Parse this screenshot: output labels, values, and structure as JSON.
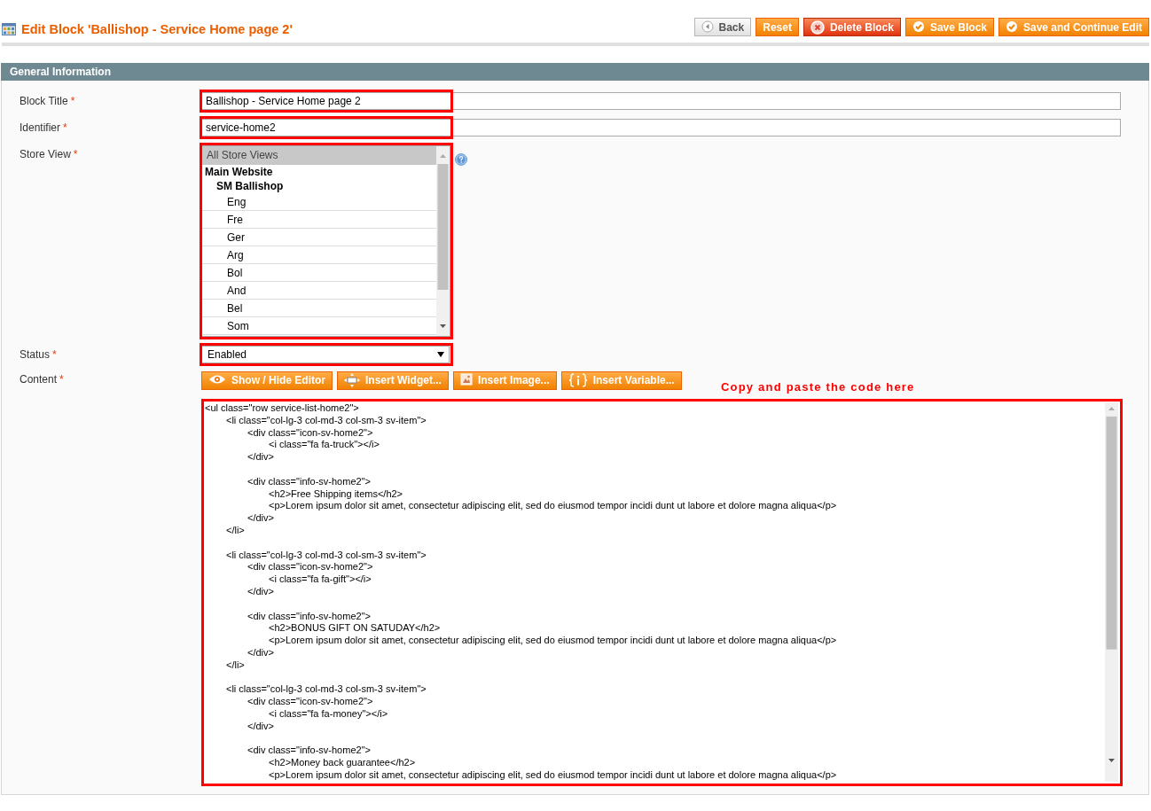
{
  "page": {
    "title": "Edit Block 'Ballishop - Service Home page 2'"
  },
  "header_buttons": [
    {
      "label": "Back",
      "kind": "back"
    },
    {
      "label": "Reset",
      "kind": "reset"
    },
    {
      "label": "Delete Block",
      "kind": "delete"
    },
    {
      "label": "Save Block",
      "kind": "save"
    },
    {
      "label": "Save and Continue Edit",
      "kind": "save"
    }
  ],
  "section": {
    "title": "General Information"
  },
  "fields": [
    {
      "kind": "text",
      "label": "Block Title",
      "required_mark": "*",
      "value": "Ballishop - Service Home page 2",
      "highlighted": true
    },
    {
      "kind": "text",
      "label": "Identifier",
      "required_mark": "*",
      "value": "service-home2",
      "highlighted": true
    },
    {
      "kind": "multiselect",
      "label": "Store View",
      "required_mark": "*",
      "highlighted": true,
      "options": [
        {
          "kind": "option",
          "label": "All Store Views",
          "selected": true
        },
        {
          "kind": "group",
          "label": "Main Website",
          "children": [
            {
              "kind": "group",
              "label": "SM Ballishop",
              "children": [
                {
                  "kind": "option",
                  "label": "Eng",
                  "selected": false
                },
                {
                  "kind": "option",
                  "label": "Fre",
                  "selected": false
                },
                {
                  "kind": "option",
                  "label": "Ger",
                  "selected": false
                },
                {
                  "kind": "option",
                  "label": "Arg",
                  "selected": false
                },
                {
                  "kind": "option",
                  "label": "Bol",
                  "selected": false
                },
                {
                  "kind": "option",
                  "label": "And",
                  "selected": false
                },
                {
                  "kind": "option",
                  "label": "Bel",
                  "selected": false
                },
                {
                  "kind": "option",
                  "label": "Som",
                  "selected": false
                }
              ]
            }
          ]
        }
      ]
    },
    {
      "kind": "select",
      "label": "Status",
      "required_mark": "*",
      "value": "Enabled",
      "highlighted": true
    },
    {
      "kind": "editor",
      "label": "Content",
      "required_mark": "*",
      "highlighted": true,
      "buttons": [
        {
          "label": "Show / Hide Editor",
          "kind": "eye"
        },
        {
          "label": "Insert Widget...",
          "kind": "widget"
        },
        {
          "label": "Insert Image...",
          "kind": "image"
        },
        {
          "label": "Insert Variable...",
          "kind": "variable"
        }
      ],
      "annotation": "Copy and paste the code here",
      "value": "<ul class=\"row service-list-home2\">\n\t<li class=\"col-lg-3 col-md-3 col-sm-3 sv-item\">\n\t\t<div class=\"icon-sv-home2\">\n\t\t\t<i class=\"fa fa-truck\"></i>\n\t\t</div>\n\n\t\t<div class=\"info-sv-home2\">\n\t\t\t<h2>Free Shipping items</h2>\n\t\t\t<p>Lorem ipsum dolor sit amet, consectetur adipiscing elit, sed do eiusmod tempor incidi dunt ut labore et dolore magna aliqua</p>\n\t\t</div>\n\t</li>\n\n\t<li class=\"col-lg-3 col-md-3 col-sm-3 sv-item\">\n\t\t<div class=\"icon-sv-home2\">\n\t\t\t<i class=\"fa fa-gift\"></i>\n\t\t</div>\n\n\t\t<div class=\"info-sv-home2\">\n\t\t\t<h2>BONUS GIFT ON SATUDAY</h2>\n\t\t\t<p>Lorem ipsum dolor sit amet, consectetur adipiscing elit, sed do eiusmod tempor incidi dunt ut labore et dolore magna aliqua</p>\n\t\t</div>\n\t</li>\n\n\t<li class=\"col-lg-3 col-md-3 col-sm-3 sv-item\">\n\t\t<div class=\"icon-sv-home2\">\n\t\t\t<i class=\"fa fa-money\"></i>\n\t\t</div>\n\n\t\t<div class=\"info-sv-home2\">\n\t\t\t<h2>Money back guarantee</h2>\n\t\t\t<p>Lorem ipsum dolor sit amet, consectetur adipiscing elit, sed do eiusmod tempor incidi dunt ut labore et dolore magna aliqua</p>"
    }
  ]
}
